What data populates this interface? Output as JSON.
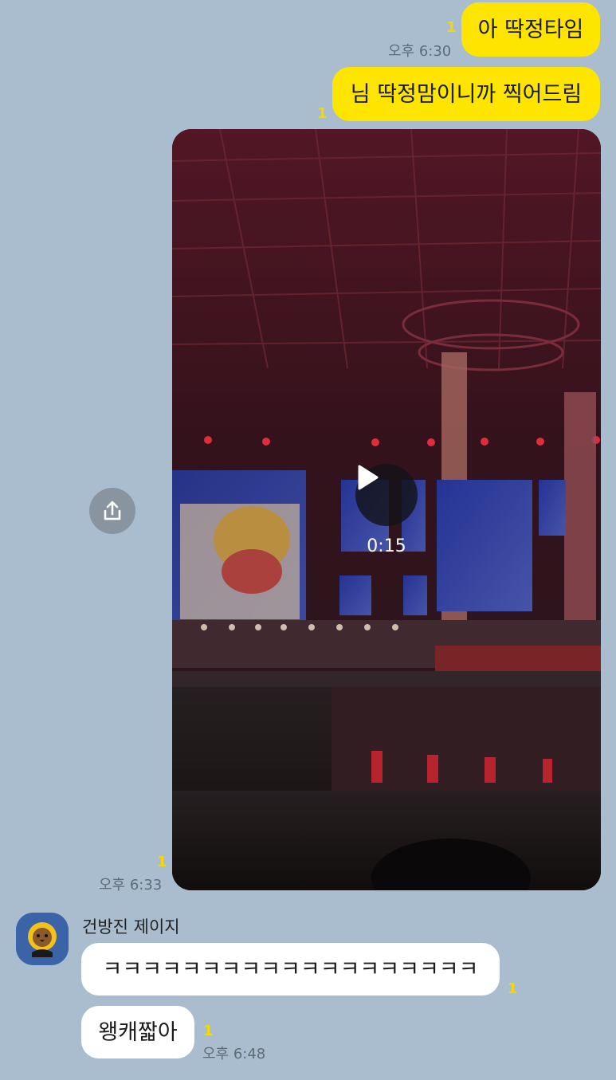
{
  "messages_out": [
    {
      "text": "아 딱정타임",
      "unread": "1",
      "time": "오후 6:30"
    },
    {
      "text": "님 딱정맘이니까 찍어드림",
      "unread": "1"
    }
  ],
  "video": {
    "duration": "0:15",
    "unread": "1",
    "time": "오후 6:33",
    "play_icon": "play-icon",
    "share_icon": "share-icon"
  },
  "incoming": {
    "sender": "건방진 제이지",
    "avatar_icon": "profile-avatar",
    "messages": [
      {
        "text": "ㅋㅋㅋㅋㅋㅋㅋㅋㅋㅋㅋㅋㅋㅋㅋㅋㅋㅋㅋ",
        "unread": "1"
      },
      {
        "text": "왱캐짧아",
        "unread": "1",
        "time": "오후 6:48"
      }
    ]
  },
  "colors": {
    "background": "#a9bdcf",
    "outgoing_bubble": "#fee500",
    "incoming_bubble": "#ffffff",
    "unread": "#f5d800"
  }
}
